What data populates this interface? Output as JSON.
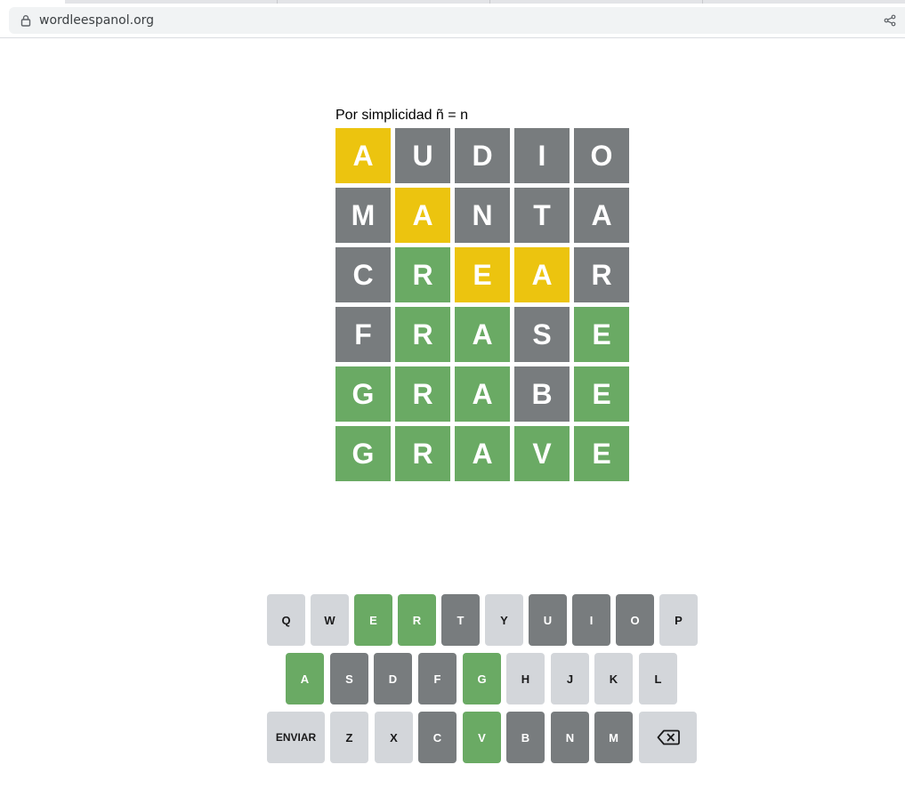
{
  "browser": {
    "url": "wordleespanol.org",
    "icons": [
      "lock-icon",
      "share-icon"
    ]
  },
  "game": {
    "note": "Por simplicidad ñ = n",
    "board": [
      [
        {
          "letter": "A",
          "state": "present"
        },
        {
          "letter": "U",
          "state": "absent"
        },
        {
          "letter": "D",
          "state": "absent"
        },
        {
          "letter": "I",
          "state": "absent"
        },
        {
          "letter": "O",
          "state": "absent"
        }
      ],
      [
        {
          "letter": "M",
          "state": "absent"
        },
        {
          "letter": "A",
          "state": "present"
        },
        {
          "letter": "N",
          "state": "absent"
        },
        {
          "letter": "T",
          "state": "absent"
        },
        {
          "letter": "A",
          "state": "absent"
        }
      ],
      [
        {
          "letter": "C",
          "state": "absent"
        },
        {
          "letter": "R",
          "state": "correct"
        },
        {
          "letter": "E",
          "state": "present"
        },
        {
          "letter": "A",
          "state": "present"
        },
        {
          "letter": "R",
          "state": "absent"
        }
      ],
      [
        {
          "letter": "F",
          "state": "absent"
        },
        {
          "letter": "R",
          "state": "correct"
        },
        {
          "letter": "A",
          "state": "correct"
        },
        {
          "letter": "S",
          "state": "absent"
        },
        {
          "letter": "E",
          "state": "correct"
        }
      ],
      [
        {
          "letter": "G",
          "state": "correct"
        },
        {
          "letter": "R",
          "state": "correct"
        },
        {
          "letter": "A",
          "state": "correct"
        },
        {
          "letter": "B",
          "state": "absent"
        },
        {
          "letter": "E",
          "state": "correct"
        }
      ],
      [
        {
          "letter": "G",
          "state": "correct"
        },
        {
          "letter": "R",
          "state": "correct"
        },
        {
          "letter": "A",
          "state": "correct"
        },
        {
          "letter": "V",
          "state": "correct"
        },
        {
          "letter": "E",
          "state": "correct"
        }
      ]
    ],
    "colors": {
      "correct": "#6aaa64",
      "present": "#ecc40f",
      "absent": "#787c7e",
      "unused": "#d3d6da"
    }
  },
  "keyboard": {
    "rows": [
      [
        {
          "label": "Q",
          "state": "unused"
        },
        {
          "label": "W",
          "state": "unused"
        },
        {
          "label": "E",
          "state": "correct"
        },
        {
          "label": "R",
          "state": "correct"
        },
        {
          "label": "T",
          "state": "absent"
        },
        {
          "label": "Y",
          "state": "unused"
        },
        {
          "label": "U",
          "state": "absent"
        },
        {
          "label": "I",
          "state": "absent"
        },
        {
          "label": "O",
          "state": "absent"
        },
        {
          "label": "P",
          "state": "unused"
        }
      ],
      [
        {
          "label": "A",
          "state": "correct"
        },
        {
          "label": "S",
          "state": "absent"
        },
        {
          "label": "D",
          "state": "absent"
        },
        {
          "label": "F",
          "state": "absent"
        },
        {
          "label": "G",
          "state": "correct"
        },
        {
          "label": "H",
          "state": "unused"
        },
        {
          "label": "J",
          "state": "unused"
        },
        {
          "label": "K",
          "state": "unused"
        },
        {
          "label": "L",
          "state": "unused"
        }
      ],
      [
        {
          "label": "ENVIAR",
          "state": "unused",
          "wide": true
        },
        {
          "label": "Z",
          "state": "unused"
        },
        {
          "label": "X",
          "state": "unused"
        },
        {
          "label": "C",
          "state": "absent"
        },
        {
          "label": "V",
          "state": "correct"
        },
        {
          "label": "B",
          "state": "absent"
        },
        {
          "label": "N",
          "state": "absent"
        },
        {
          "label": "M",
          "state": "absent"
        },
        {
          "label": "",
          "state": "unused",
          "wide": true,
          "icon": "backspace-icon"
        }
      ]
    ]
  }
}
